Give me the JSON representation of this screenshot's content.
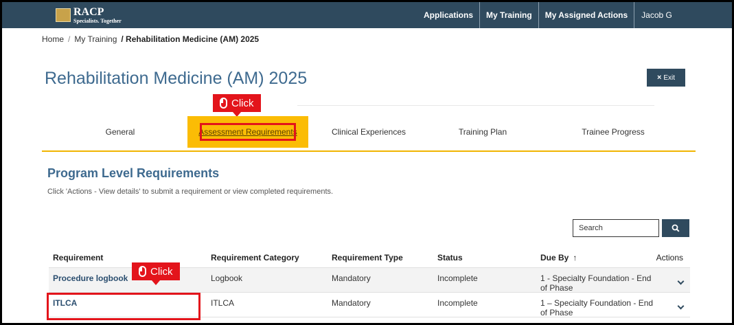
{
  "header": {
    "logo_name": "RACP",
    "logo_tagline": "Specialists. Together",
    "nav": [
      "Applications",
      "My Training",
      "My Assigned Actions"
    ],
    "user": "Jacob G"
  },
  "breadcrumb": {
    "home": "Home",
    "sep": "/",
    "training": "My Training",
    "current": "/ Rehabilitation Medicine (AM) 2025"
  },
  "page": {
    "title": "Rehabilitation Medicine (AM) 2025",
    "exit_label": "Exit",
    "exit_icon": "×"
  },
  "tabs": {
    "general": "General",
    "assessment": "Assessment Requirements",
    "clinical": "Clinical Experiences",
    "training_plan": "Training Plan",
    "progress": "Trainee Progress",
    "active": "Assessment Requirements"
  },
  "callouts": {
    "click": "Click"
  },
  "section": {
    "title": "Program Level Requirements",
    "description": "Click 'Actions - View details' to submit a requirement or view completed requirements."
  },
  "search": {
    "placeholder": "Search"
  },
  "table": {
    "headers": {
      "requirement": "Requirement",
      "category": "Requirement Category",
      "type": "Requirement Type",
      "status": "Status",
      "due": "Due By",
      "due_sort": "↑",
      "actions": "Actions"
    },
    "rows": [
      {
        "requirement": "Procedure logbook",
        "category": "Logbook",
        "type": "Mandatory",
        "status": "Incomplete",
        "due": "1 - Specialty Foundation - End of Phase"
      },
      {
        "requirement": "ITLCA",
        "category": "ITLCA",
        "type": "Mandatory",
        "status": "Incomplete",
        "due": "1 – Specialty Foundation - End of Phase"
      }
    ]
  },
  "colors": {
    "nav": "#2f4a5e",
    "accent": "#fbbc05",
    "highlight": "#e3141b",
    "title": "#3e6a8f"
  }
}
